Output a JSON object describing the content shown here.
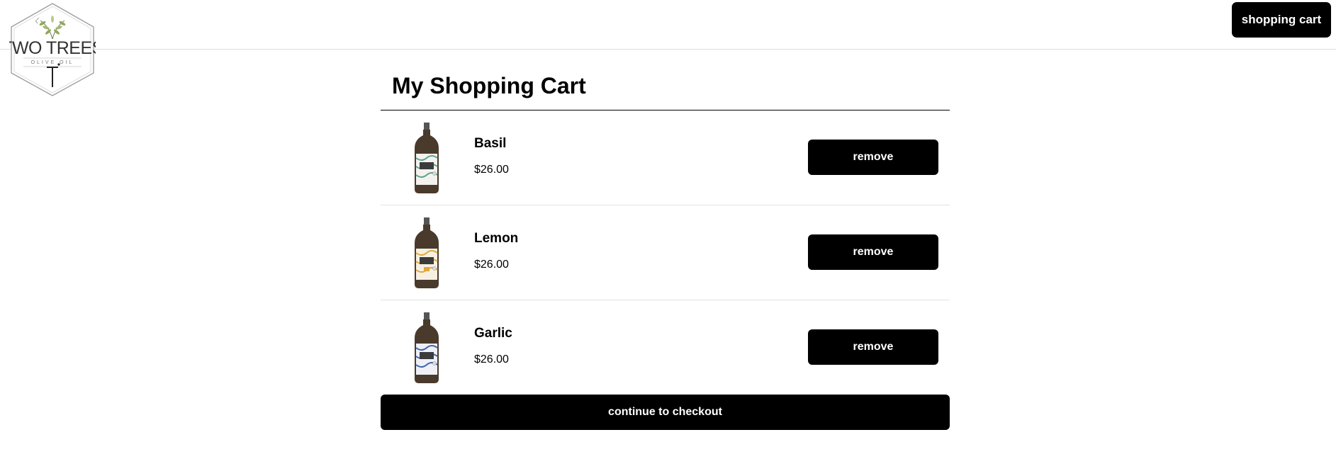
{
  "header": {
    "logo_text": "TWO TREES",
    "logo_subtext": "OLIVE OIL",
    "cart_button_label": "shopping cart"
  },
  "cart": {
    "title": "My Shopping Cart",
    "items": [
      {
        "name": "Basil",
        "price": "$26.00",
        "remove_label": "remove",
        "label_color": "#5aa38c"
      },
      {
        "name": "Lemon",
        "price": "$26.00",
        "remove_label": "remove",
        "label_color": "#e0a83a"
      },
      {
        "name": "Garlic",
        "price": "$26.00",
        "remove_label": "remove",
        "label_color": "#3f63a8"
      }
    ],
    "checkout_label": "continue to checkout"
  },
  "colors": {
    "button_bg": "#000000",
    "button_text": "#ffffff",
    "divider": "#e2e2e2"
  }
}
